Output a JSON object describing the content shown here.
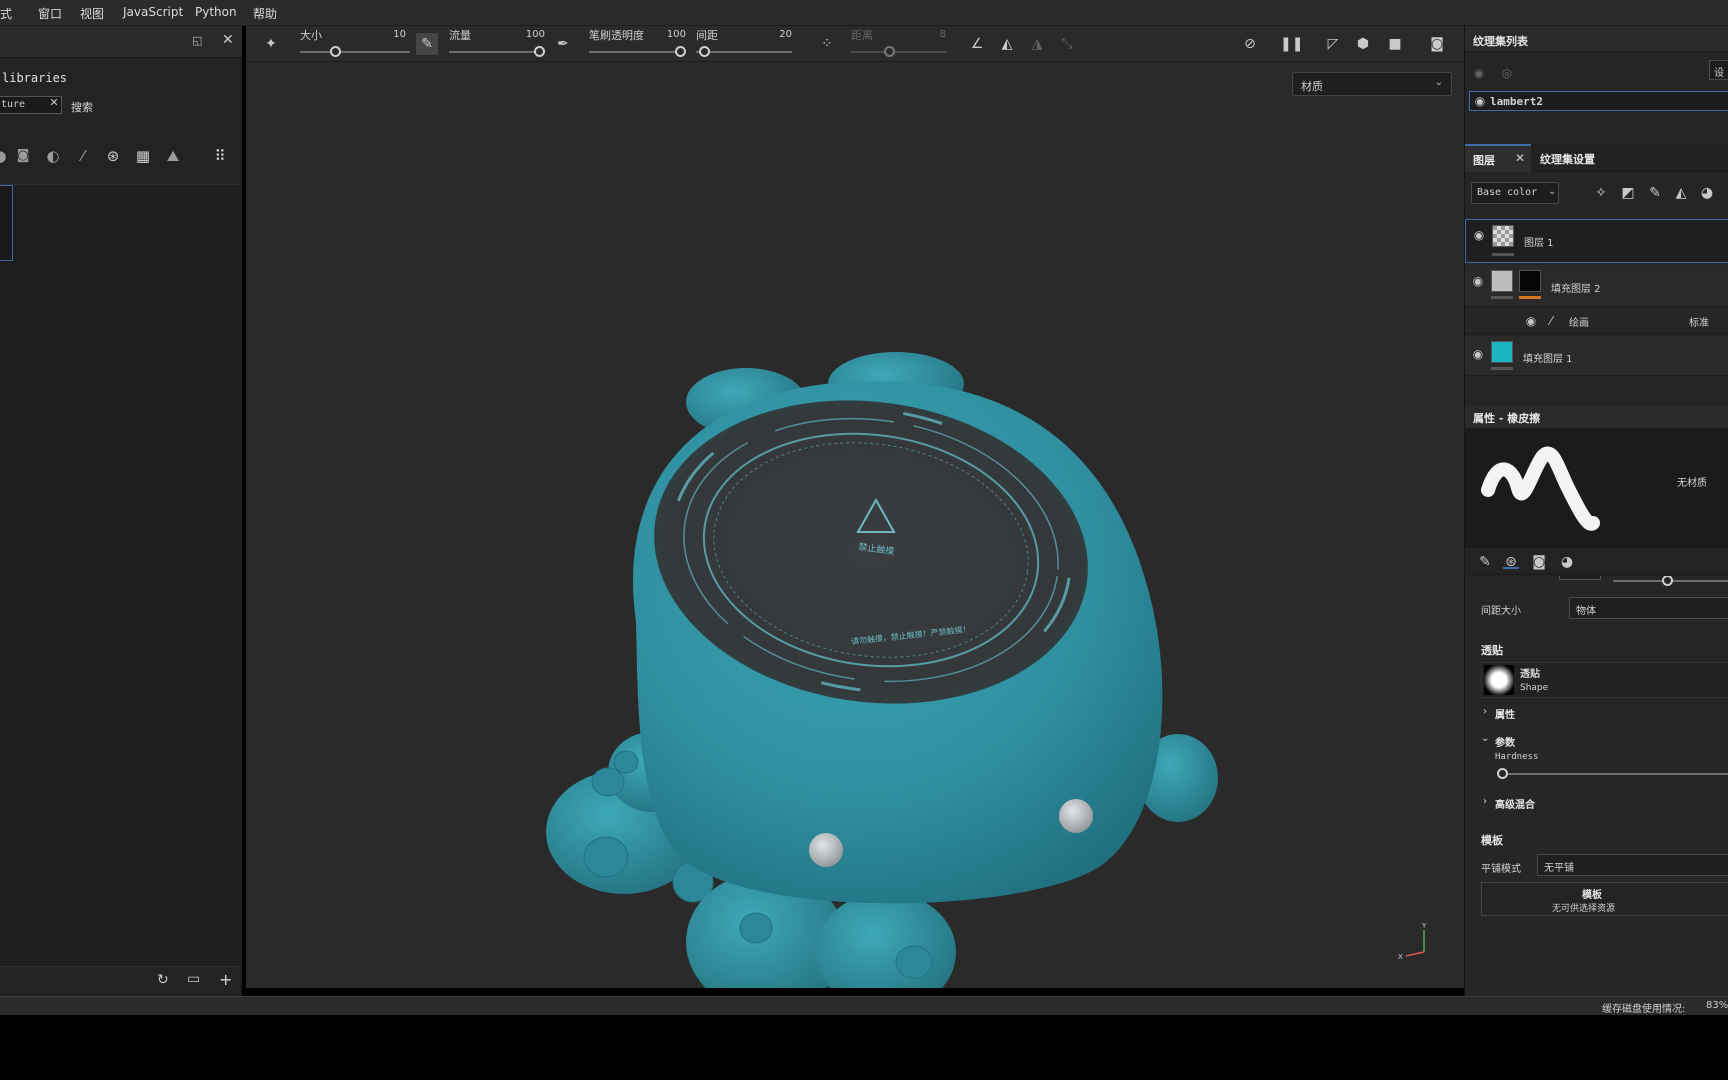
{
  "menubar": {
    "items": [
      "模式",
      "窗口",
      "视图",
      "JavaScript",
      "Python",
      "帮助"
    ],
    "first_visible": "式"
  },
  "left_panel": {
    "title": "libraries",
    "search_value": "ture",
    "search_label": "搜索",
    "filter_icons": [
      "material-filter-icon",
      "mask-filter-icon",
      "smart-material-icon",
      "brush-filter-icon",
      "alpha-filter-icon",
      "procedural-filter-icon",
      "environment-filter-icon"
    ]
  },
  "toolbar": {
    "size_label": "大小",
    "size_value": "10",
    "flow_label": "流量",
    "flow_value": "100",
    "opacity_label": "笔刷透明度",
    "opacity_value": "100",
    "spacing_label": "间距",
    "spacing_value": "20",
    "distance_label": "距离",
    "distance_value": "8"
  },
  "viewport": {
    "display_mode": "材质",
    "model_logo_text": "禁止触摸",
    "model_ring_text": "请勿触摸，禁止触摸！严禁触摸！",
    "axis_y": "Y",
    "axis_x": "X"
  },
  "texture_set_list": {
    "title": "纹理集列表",
    "settings_label": "设置",
    "item": "lambert2"
  },
  "layers_panel": {
    "tab_layers": "图层",
    "tab_texture_settings": "纹理集设置",
    "channel": "Base color",
    "layers": [
      {
        "name": "图层 1"
      },
      {
        "name": "填充图层 2"
      },
      {
        "name": "绘画",
        "blend": "标准"
      },
      {
        "name": "填充图层 1"
      }
    ]
  },
  "properties": {
    "title": "属性 - 橡皮擦",
    "no_material": "无材质",
    "spacing_size_label": "间距大小",
    "spacing_size_value": "物体",
    "alpha_section": "透贴",
    "alpha_name": "透贴",
    "alpha_shape": "Shape",
    "attributes": "属性",
    "parameters": "参数",
    "hardness_label": "Hardness",
    "advanced_blend": "高级混合",
    "stencil_section": "模板",
    "tiling_label": "平铺模式",
    "tiling_value": "无平铺",
    "stencil_button_title": "模板",
    "stencil_button_sub": "无可供选择资源"
  },
  "statusbar": {
    "cache_label": "缓存磁盘使用情况:",
    "cache_value": "83%"
  },
  "colors": {
    "model_teal": "#2f8fa0",
    "accent_blue": "#3d6aa8",
    "orange_indicator": "#d4741f"
  }
}
